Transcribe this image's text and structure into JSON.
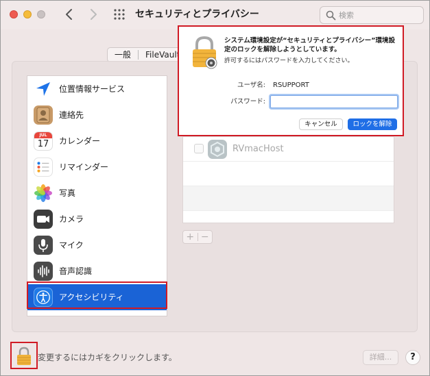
{
  "window": {
    "title": "セキュリティとプライバシー",
    "search_placeholder": "検索"
  },
  "tabs": [
    {
      "label": "一般"
    },
    {
      "label": "FileVault"
    }
  ],
  "sidebar": {
    "items": [
      {
        "label": "位置情報サービス",
        "icon": "location-icon"
      },
      {
        "label": "連絡先",
        "icon": "contacts-icon"
      },
      {
        "label": "カレンダー",
        "icon": "calendar-icon",
        "icon_month": "JUL",
        "icon_day": "17"
      },
      {
        "label": "リマインダー",
        "icon": "reminders-icon"
      },
      {
        "label": "写真",
        "icon": "photos-icon"
      },
      {
        "label": "カメラ",
        "icon": "camera-icon"
      },
      {
        "label": "マイク",
        "icon": "microphone-icon"
      },
      {
        "label": "音声認識",
        "icon": "speech-recognition-icon"
      },
      {
        "label": "アクセシビリティ",
        "icon": "accessibility-icon",
        "selected": true
      }
    ]
  },
  "app_list": {
    "apps": [
      {
        "name": "RVmacHost",
        "checked": false
      }
    ],
    "add_label": "+",
    "remove_label": "−"
  },
  "bottom": {
    "lock_text": "変更するにはカギをクリックします。",
    "details_label": "詳細...",
    "help_label": "?"
  },
  "auth_dialog": {
    "title": "システム環境設定が“セキュリティとプライバシー”環境設定のロックを解除しようとしています。",
    "subtitle": "許可するにはパスワードを入力してください。",
    "username_label": "ユーザ名:",
    "username_value": "RSUPPORT",
    "password_label": "パスワード:",
    "password_value": "",
    "cancel_label": "キャンセル",
    "unlock_label": "ロックを解除"
  },
  "colors": {
    "accent": "#1a63d6",
    "highlight_outline": "#d01a24",
    "unlock_button": "#1f6ee6"
  }
}
